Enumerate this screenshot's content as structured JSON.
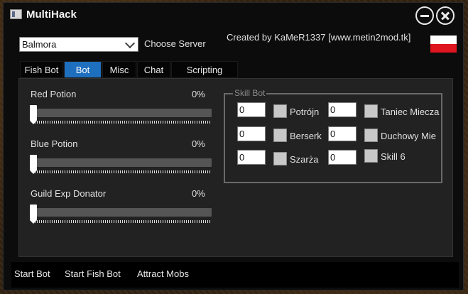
{
  "window": {
    "title": "MultiHack"
  },
  "server": {
    "selected": "Balmora",
    "label": "Choose Server"
  },
  "credit": "Created by KaMeR1337 [www.metin2mod.tk]",
  "flag": {
    "top_color": "#ffffff",
    "bottom_color": "#e0141e",
    "icon": "poland-flag-icon"
  },
  "tabs": [
    {
      "label": "Fish Bot",
      "active": false
    },
    {
      "label": "Bot",
      "active": true
    },
    {
      "label": "Misc",
      "active": false
    },
    {
      "label": "Chat",
      "active": false
    },
    {
      "label": "Scripting",
      "active": false
    }
  ],
  "sliders": [
    {
      "label": "Red Potion",
      "value_text": "0%",
      "value": 0
    },
    {
      "label": "Blue Potion",
      "value_text": "0%",
      "value": 0
    },
    {
      "label": "Guild Exp Donator",
      "value_text": "0%",
      "value": 0
    }
  ],
  "skill_bot": {
    "title": "Skill Bot",
    "left": [
      {
        "value": "0",
        "label": "Potrójn"
      },
      {
        "value": "0",
        "label": "Berserk"
      },
      {
        "value": "0",
        "label": "Szarża"
      }
    ],
    "right": [
      {
        "value": "0",
        "label": "Taniec Miecza"
      },
      {
        "value": "0",
        "label": "Duchowy Mie"
      },
      {
        "value": "0",
        "label": "Skill 6"
      }
    ]
  },
  "bottom": {
    "start_bot": "Start Bot",
    "start_fish_bot": "Start Fish Bot",
    "attract_mobs": "Attract Mobs"
  },
  "colors": {
    "accent": "#1f6fbf",
    "panel": "#222222",
    "window": "#0c0c0c"
  }
}
